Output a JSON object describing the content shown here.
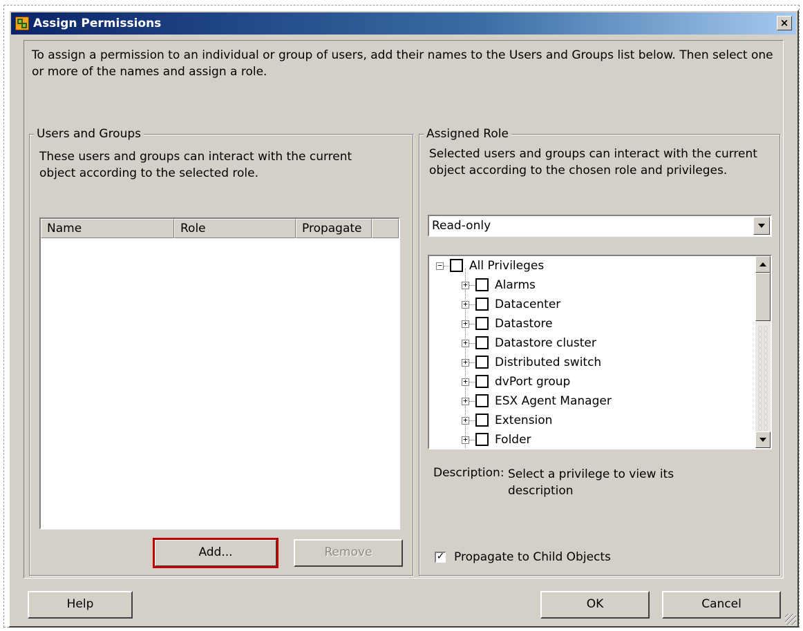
{
  "window": {
    "title": "Assign Permissions",
    "close_glyph": "×"
  },
  "intro_text": "To assign a permission to an individual or group of users, add their names to the Users and Groups list below. Then select one or more of the names and assign a role.",
  "users_groups": {
    "title": "Users and Groups",
    "description": "These users and groups can interact with the current object according to the selected role.",
    "columns": [
      "Name",
      "Role",
      "Propagate"
    ],
    "rows": [],
    "add_label": "Add...",
    "remove_label": "Remove"
  },
  "assigned_role": {
    "title": "Assigned Role",
    "description": "Selected users and groups can interact with the current object according to the chosen role and privileges.",
    "selected_role": "Read-only",
    "privileges_root": "All Privileges",
    "privileges": [
      "Alarms",
      "Datacenter",
      "Datastore",
      "Datastore cluster",
      "Distributed switch",
      "dvPort group",
      "ESX Agent Manager",
      "Extension",
      "Folder"
    ],
    "description_label": "Description:",
    "description_value": "Select a privilege to view its description",
    "propagate_label": "Propagate to Child Objects",
    "propagate_checked": true
  },
  "footer": {
    "help_label": "Help",
    "ok_label": "OK",
    "cancel_label": "Cancel"
  },
  "icons": {
    "expand": "plus-box-icon",
    "collapse": "minus-box-icon",
    "checkbox": "checkbox-icon"
  }
}
